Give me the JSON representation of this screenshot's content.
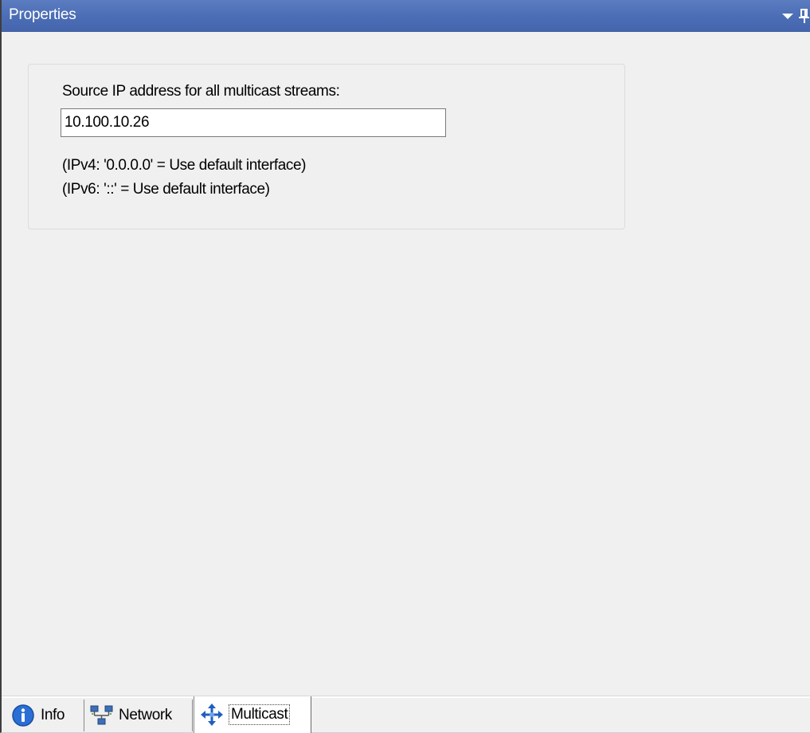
{
  "window": {
    "title": "Properties",
    "dropdown_icon": "dropdown-arrow-icon",
    "pin_icon": "pin-icon"
  },
  "multicast": {
    "source_ip_label": "Source IP address for all multicast streams:",
    "source_ip_value": "10.100.10.26",
    "hint_ipv4": "(IPv4: '0.0.0.0' = Use default interface)",
    "hint_ipv6": "(IPv6: '::' = Use default interface)"
  },
  "tabs": [
    {
      "label": "Info",
      "icon": "info-icon",
      "selected": false
    },
    {
      "label": "Network",
      "icon": "network-icon",
      "selected": false
    },
    {
      "label": "Multicast",
      "icon": "multicast-icon",
      "selected": true
    }
  ],
  "colors": {
    "titlebar": "#4b6db5",
    "panel_background": "#f0f0f0",
    "info_icon": "#2a6fd6",
    "multicast_icon": "#1f5fbf"
  }
}
